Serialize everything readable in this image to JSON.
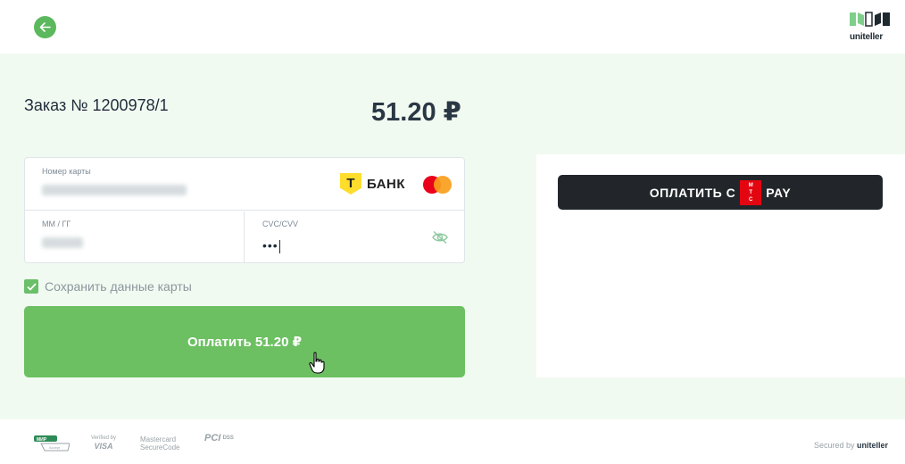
{
  "header": {
    "back_icon": "arrow-left-icon",
    "logo_text": "uniteller",
    "brand_color": "#5cb85c"
  },
  "order": {
    "title": "Заказ № 1200978/1",
    "amount": "51.20 ₽"
  },
  "card_form": {
    "card_number_label": "Номер карты",
    "bank_name": "БАНК",
    "bank_letter": "Т",
    "expiry_label": "ММ / ГГ",
    "cvc_label": "CVC/CVV",
    "cvc_value": "•••"
  },
  "save_card": {
    "label": "Сохранить данные карты",
    "checked": true
  },
  "pay_button": {
    "label": "Оплатить 51.20 ₽",
    "color": "#6cc062"
  },
  "mts_pay": {
    "label_prefix": "ОПЛАТИТЬ С",
    "label_suffix": "PAY",
    "badge_letters": [
      "М",
      "Т",
      "С"
    ]
  },
  "footer": {
    "mir_top": "МИР",
    "mir_bottom": "Accept",
    "visa_line1": "Verified by",
    "visa_line2": "VISA",
    "mc_line1": "Mastercard",
    "mc_line2": "SecureCode",
    "pci_text": "PCI",
    "dss_text": "DSS",
    "secured_prefix": "Secured by",
    "secured_brand": "uniteller"
  }
}
